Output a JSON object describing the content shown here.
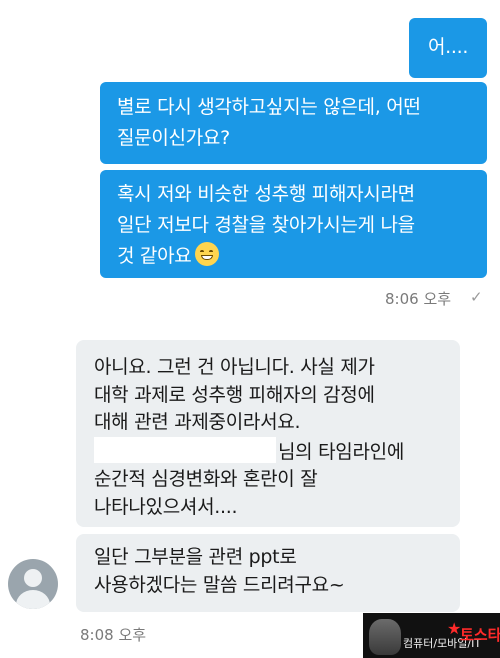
{
  "messages_out": [
    {
      "lines": [
        "어...."
      ]
    },
    {
      "lines": [
        "별로 다시 생각하고싶지는 않은데, 어떤",
        "질문이신가요?"
      ]
    },
    {
      "lines": [
        "혹시 저와 비슷한 성추행 피해자시라면",
        "일단 저보다 경찰을 찾아가시는게 나을",
        "것 같아요"
      ]
    }
  ],
  "out_time": "8:06 오후",
  "read_check": "✓",
  "messages_in": [
    {
      "lines": [
        "아니요. 그런 건 아닙니다. 사실 제가",
        "대학 과제로 성추행 피해자의 감정에",
        "대해 관련 과제중이라서요.",
        "님의 타임라인에",
        "순간적 심경변화와 혼란이 잘",
        "나타나있으셔서...."
      ]
    },
    {
      "lines": [
        "일단 그부분을 관련 ppt로",
        "사용하겠다는 말씀 드리려구요~"
      ]
    }
  ],
  "in_time": "8:08 오후",
  "emoji": "grinning-face-icon",
  "watermark": {
    "label": "컴퓨터/모바일/IT",
    "brand": "토스타"
  },
  "colors": {
    "outgoing": "#1b98e6",
    "incoming": "#eceff1"
  }
}
